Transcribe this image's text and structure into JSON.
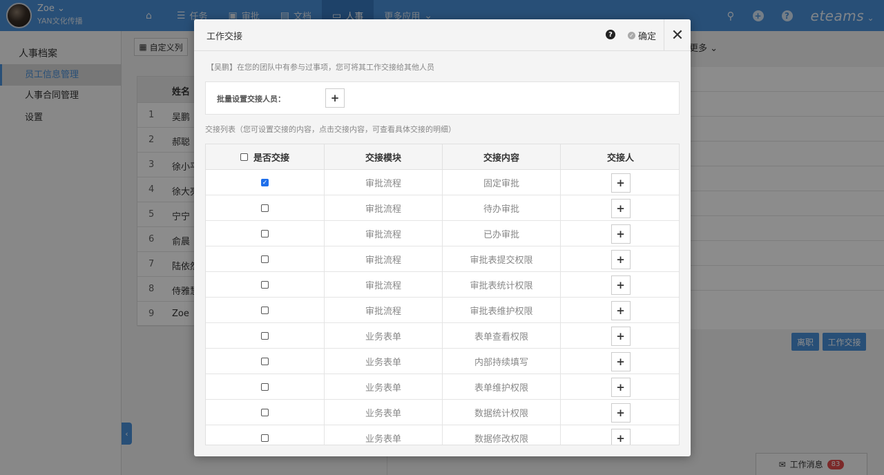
{
  "header": {
    "user_name": "Zoe",
    "user_org": "YAN文化传播",
    "nav": [
      {
        "label": "",
        "icon": "home-icon"
      },
      {
        "label": "任务",
        "icon": "list-icon"
      },
      {
        "label": "审批",
        "icon": "approval-icon"
      },
      {
        "label": "文档",
        "icon": "document-icon"
      },
      {
        "label": "人事",
        "icon": "hr-icon"
      },
      {
        "label": "更多应用",
        "icon": "chevron-down-icon"
      }
    ],
    "brand": "eteams"
  },
  "sidebar": {
    "title": "人事档案",
    "items": [
      {
        "label": "员工信息管理",
        "active": true
      },
      {
        "label": "人事合同管理",
        "active": false
      },
      {
        "label": "设置",
        "active": false
      }
    ]
  },
  "background": {
    "custom_columns_label": "自定义列",
    "more_label": "更多",
    "name_header": "姓名",
    "rows": [
      {
        "num": "1",
        "name": "吴鹏"
      },
      {
        "num": "2",
        "name": "郝聪"
      },
      {
        "num": "3",
        "name": "徐小平"
      },
      {
        "num": "4",
        "name": "徐大亮"
      },
      {
        "num": "5",
        "name": "宁宁"
      },
      {
        "num": "6",
        "name": "俞晨"
      },
      {
        "num": "7",
        "name": "陆依然"
      },
      {
        "num": "8",
        "name": "侍雅慧"
      },
      {
        "num": "9",
        "name": "Zoe"
      }
    ],
    "resign_label": "离职",
    "handover_label": "工作交接",
    "chat_label": "工作消息",
    "chat_count": "83"
  },
  "modal": {
    "title": "工作交接",
    "help_label": "?",
    "confirm_label": "确定",
    "tip": "【吴鹏】在您的团队中有参与过事项，您可将其工作交接给其他人员",
    "batch_label": "批量设置交接人员：",
    "list_tip": "交接列表（您可设置交接的内容，点击交接内容，可查看具体交接的明细）",
    "columns": [
      "是否交接",
      "交接模块",
      "交接内容",
      "交接人"
    ],
    "rows": [
      {
        "module": "审批流程",
        "content": "固定审批",
        "checked": true
      },
      {
        "module": "审批流程",
        "content": "待办审批",
        "checked": false
      },
      {
        "module": "审批流程",
        "content": "已办审批",
        "checked": false
      },
      {
        "module": "审批流程",
        "content": "审批表提交权限",
        "checked": false
      },
      {
        "module": "审批流程",
        "content": "审批表统计权限",
        "checked": false
      },
      {
        "module": "审批流程",
        "content": "审批表维护权限",
        "checked": false
      },
      {
        "module": "业务表单",
        "content": "表单查看权限",
        "checked": false
      },
      {
        "module": "业务表单",
        "content": "内部持续填写",
        "checked": false
      },
      {
        "module": "业务表单",
        "content": "表单维护权限",
        "checked": false
      },
      {
        "module": "业务表单",
        "content": "数据统计权限",
        "checked": false
      },
      {
        "module": "业务表单",
        "content": "数据修改权限",
        "checked": false
      }
    ]
  }
}
